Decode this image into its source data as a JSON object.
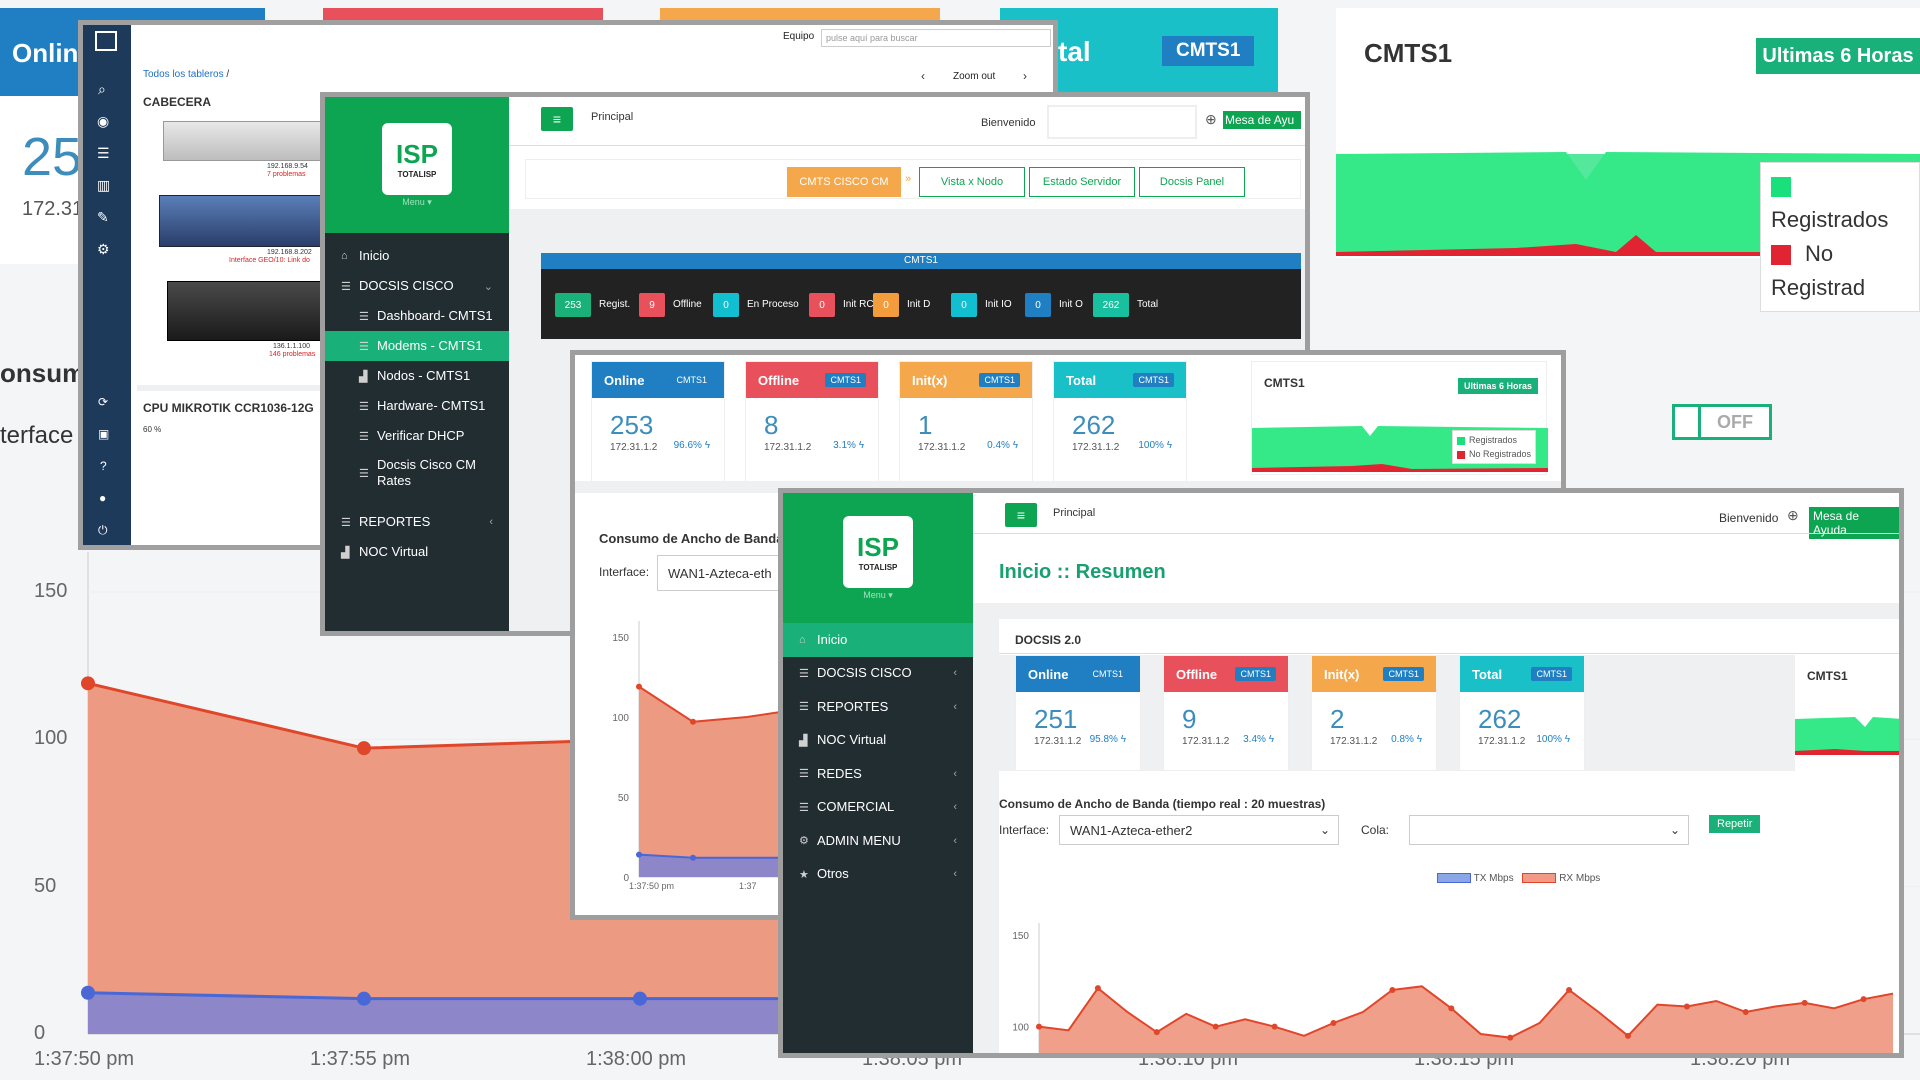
{
  "background": {
    "online_label": "Onlin",
    "online_num": "25",
    "online_ip": "172.31",
    "total_label": "tal",
    "total_badge": "CMTS1",
    "cmts_title": "CMTS1",
    "range_button": "Ultimas 6 Horas",
    "legend": [
      "Registrados",
      "No Registrad"
    ],
    "consumo": "onsum",
    "interface": "terface",
    "off_toggle": "OFF",
    "yticks": [
      "150",
      "100",
      "50",
      "0"
    ],
    "xticks": [
      "1:37:50 pm",
      "1:37:55 pm",
      "1:38:00 pm",
      "1:38:05 pm",
      "1:38:10 pm",
      "1:38:15 pm",
      "1:38:20 pm"
    ]
  },
  "win1": {
    "equipo_label": "Equipo",
    "search_placeholder": "pulse aquí para buscar",
    "breadcrumb": "Todos los tableros",
    "breadcrumb_sep": "/",
    "zoom_out": "Zoom out",
    "cabecera": "CABECERA",
    "devices": [
      {
        "ip": "192.168.9.54",
        "problems": "7 problemas"
      },
      {
        "ip": "192.168.8.202",
        "problems": "Interface GEO/10: Link do"
      },
      {
        "ip": "136.1.1.100",
        "problems": "146 problemas"
      }
    ],
    "cpu_title": "CPU MIKROTIK CCR1036-12G",
    "cpu_tick": "60 %"
  },
  "win2": {
    "logo_text": "ISP",
    "logo_sub": "TOTALISP",
    "logo_menu": "Menu ▾",
    "principal": "Principal",
    "bienvenido": "Bienvenido",
    "mesa": "Mesa de Ayu",
    "menu": [
      {
        "label": "Inicio",
        "icon": "⌂"
      },
      {
        "label": "DOCSIS CISCO",
        "icon": "☰",
        "chev": "⌄"
      },
      {
        "label": "Dashboard- CMTS1",
        "icon": "☰"
      },
      {
        "label": "Modems - CMTS1",
        "icon": "☰"
      },
      {
        "label": "Nodos - CMTS1",
        "icon": "▟"
      },
      {
        "label": "Hardware- CMTS1",
        "icon": "☰"
      },
      {
        "label": "Verificar DHCP",
        "icon": "☰"
      },
      {
        "label": "Docsis Cisco CM",
        "label2": "Rates",
        "icon": "☰"
      },
      {
        "label": "REPORTES",
        "icon": "☰",
        "chev": "‹"
      },
      {
        "label": "NOC Virtual",
        "icon": "▟"
      }
    ],
    "tabs": [
      "CMTS CISCO CM",
      "Vista x Nodo",
      "Estado Servidor",
      "Docsis Panel"
    ],
    "tab_arrow": "»",
    "cmts_bar": "CMTS1",
    "stats": [
      {
        "value": "253",
        "label": "Regist.",
        "color": "#19b07a"
      },
      {
        "value": "9",
        "label": "Offline",
        "color": "#e8505b"
      },
      {
        "value": "0",
        "label": "En Proceso",
        "color": "#12bfd0"
      },
      {
        "value": "0",
        "label": "Init RC",
        "color": "#e8505b"
      },
      {
        "value": "0",
        "label": "Init D",
        "color": "#f39c3b"
      },
      {
        "value": "0",
        "label": "Init IO",
        "color": "#12bfd0"
      },
      {
        "value": "0",
        "label": "Init O",
        "color": "#1f7fc2"
      },
      {
        "value": "262",
        "label": "Total",
        "color": "#19c0a0"
      }
    ]
  },
  "win3": {
    "cards": [
      {
        "title": "Online",
        "badge": "CMTS1",
        "value": "253",
        "ip": "172.31.1.2",
        "pct": "96.6%",
        "color": "#1f7fc2"
      },
      {
        "title": "Offline",
        "badge": "CMTS1",
        "value": "8",
        "ip": "172.31.1.2",
        "pct": "3.1%",
        "color": "#e8505b"
      },
      {
        "title": "Init(x)",
        "badge": "CMTS1",
        "value": "1",
        "ip": "172.31.1.2",
        "pct": "0.4%",
        "color": "#f5a84b"
      },
      {
        "title": "Total",
        "badge": "CMTS1",
        "value": "262",
        "ip": "172.31.1.2",
        "pct": "100%",
        "color": "#19c0c8"
      }
    ],
    "cmts_title": "CMTS1",
    "range_button": "Ultimas 6 Horas",
    "legend": [
      "Registrados",
      "No Registrados"
    ],
    "consumo": "Consumo de Ancho de Banda (",
    "interface_label": "Interface:",
    "interface_value": "WAN1-Azteca-eth",
    "yticks": [
      "150",
      "100",
      "50",
      "0"
    ],
    "xticks": [
      "1:37:50 pm",
      "1:37"
    ]
  },
  "win4": {
    "logo_text": "ISP",
    "logo_sub": "TOTALISP",
    "logo_menu": "Menu ▾",
    "principal": "Principal",
    "bienvenido": "Bienvenido",
    "mesa": "Mesa de Ayuda",
    "page_title": "Inicio :: Resumen",
    "docsis": "DOCSIS 2.0",
    "menu": [
      {
        "label": "Inicio",
        "icon": "⌂"
      },
      {
        "label": "DOCSIS CISCO",
        "icon": "☰",
        "chev": "‹"
      },
      {
        "label": "REPORTES",
        "icon": "☰",
        "chev": "‹"
      },
      {
        "label": "NOC Virtual",
        "icon": "▟"
      },
      {
        "label": "REDES",
        "icon": "☰",
        "chev": "‹"
      },
      {
        "label": "COMERCIAL",
        "icon": "☰",
        "chev": "‹"
      },
      {
        "label": "ADMIN MENU",
        "icon": "⚙",
        "chev": "‹"
      },
      {
        "label": "Otros",
        "icon": "★",
        "chev": "‹"
      }
    ],
    "cards": [
      {
        "title": "Online",
        "badge": "CMTS1",
        "value": "251",
        "ip": "172.31.1.2",
        "pct": "95.8%",
        "color": "#1f7fc2"
      },
      {
        "title": "Offline",
        "badge": "CMTS1",
        "value": "9",
        "ip": "172.31.1.2",
        "pct": "3.4%",
        "color": "#e8505b"
      },
      {
        "title": "Init(x)",
        "badge": "CMTS1",
        "value": "2",
        "ip": "172.31.1.2",
        "pct": "0.8%",
        "color": "#f5a84b"
      },
      {
        "title": "Total",
        "badge": "CMTS1",
        "value": "262",
        "ip": "172.31.1.2",
        "pct": "100%",
        "color": "#19c0c8"
      }
    ],
    "cmts_title": "CMTS1",
    "consumo": "Consumo de Ancho de Banda (tiempo real : 20 muestras)",
    "interface_label": "Interface:",
    "interface_value": "WAN1-Azteca-ether2",
    "cola_label": "Cola:",
    "cola_value": "",
    "repetir": "Repetir",
    "legend_tx": "TX Mbps",
    "legend_rx": "RX Mbps",
    "yticks": [
      "150",
      "100"
    ]
  },
  "chart_data": [
    {
      "type": "area",
      "title": "",
      "x": [
        "1:37:50 pm",
        "1:37:55 pm",
        "1:38:00 pm",
        "1:38:05 pm",
        "1:38:10 pm",
        "1:38:15 pm",
        "1:38:20 pm"
      ],
      "series": [
        {
          "name": "",
          "values": [
            119,
            97,
            100,
            105,
            110,
            112,
            114
          ],
          "color": "#e0462a"
        },
        {
          "name": "",
          "values": [
            14,
            12,
            12,
            12,
            12,
            12,
            12
          ],
          "color": "#4a67d6"
        }
      ],
      "ylim": [
        0,
        150
      ]
    },
    {
      "type": "area",
      "title": "",
      "series": [
        {
          "name": "TX Mbps",
          "values": [],
          "color": "#4a67d6"
        },
        {
          "name": "RX Mbps",
          "values": [
            100,
            98,
            121,
            108,
            97,
            107,
            100,
            104,
            100,
            95,
            102,
            108,
            120,
            122,
            110,
            96,
            94,
            102,
            120,
            108,
            95,
            112,
            111,
            114,
            108,
            111,
            113,
            110,
            115,
            118
          ],
          "color": "#e0462a"
        }
      ],
      "ylim": [
        90,
        150
      ]
    }
  ]
}
